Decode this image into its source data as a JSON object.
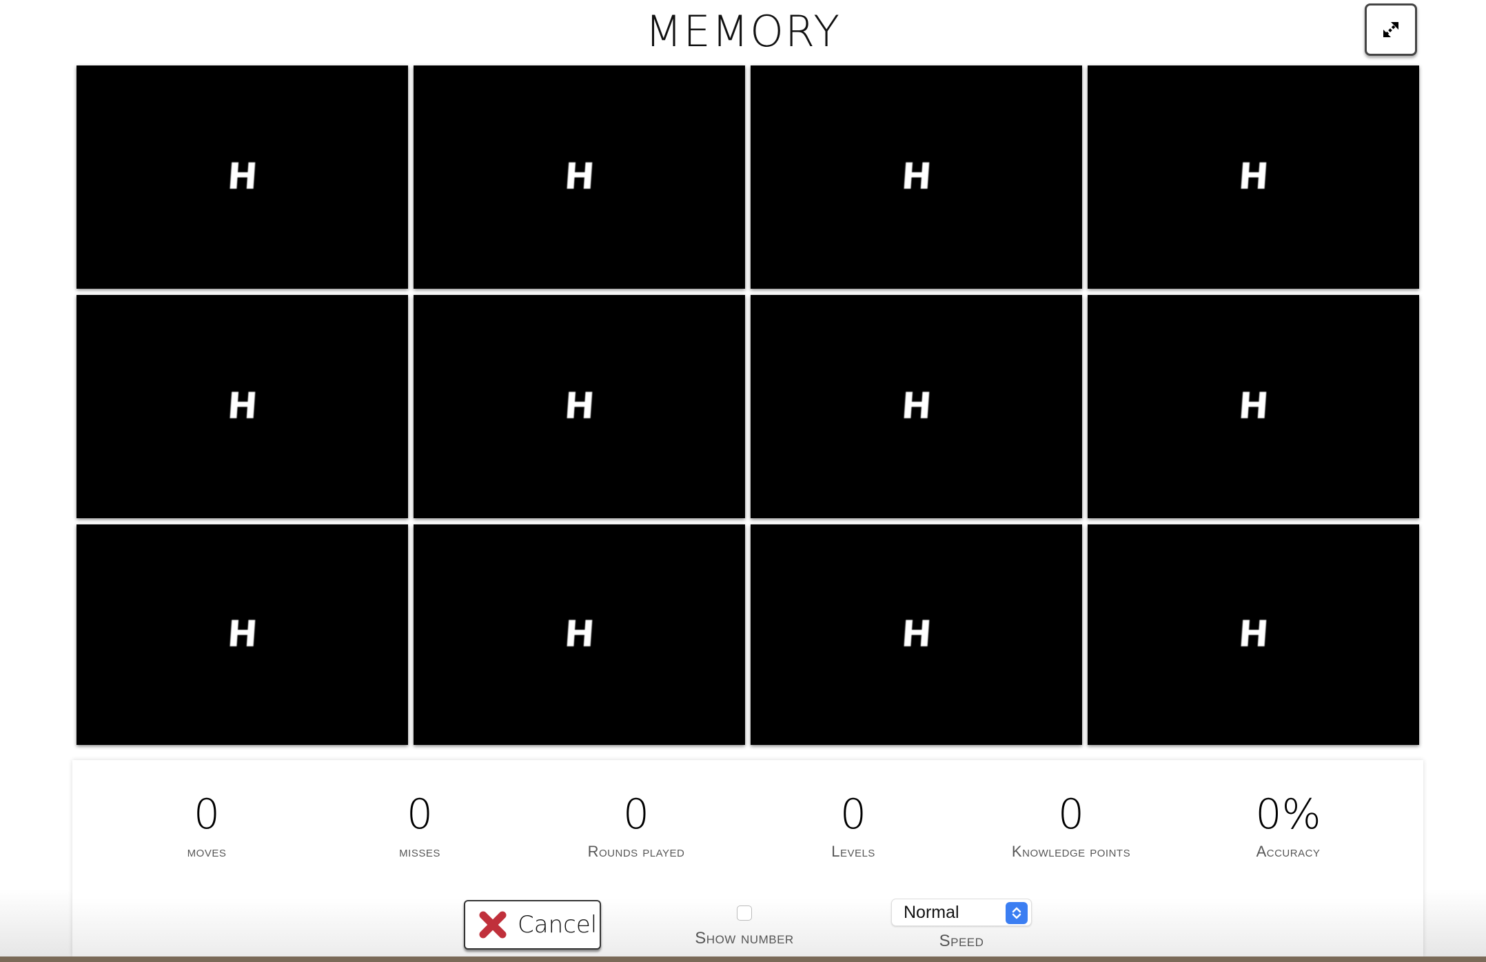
{
  "header": {
    "title": "MEMORY",
    "fullscreen_icon": "expand-arrows-icon"
  },
  "cards": [
    {
      "glyph": "H",
      "state": "face-down"
    },
    {
      "glyph": "H",
      "state": "face-down"
    },
    {
      "glyph": "H",
      "state": "face-down"
    },
    {
      "glyph": "H",
      "state": "face-down"
    },
    {
      "glyph": "H",
      "state": "face-down"
    },
    {
      "glyph": "H",
      "state": "face-down"
    },
    {
      "glyph": "H",
      "state": "face-down"
    },
    {
      "glyph": "H",
      "state": "face-down"
    },
    {
      "glyph": "H",
      "state": "face-down"
    },
    {
      "glyph": "H",
      "state": "face-down"
    },
    {
      "glyph": "H",
      "state": "face-down"
    },
    {
      "glyph": "H",
      "state": "face-down"
    }
  ],
  "stats": [
    {
      "value": "0",
      "label": "moves"
    },
    {
      "value": "0",
      "label": "misses"
    },
    {
      "value": "0",
      "label": "Rounds played"
    },
    {
      "value": "0",
      "label": "Levels"
    },
    {
      "value": "0",
      "label": "Knowledge points"
    },
    {
      "value": "0%",
      "label": "Accuracy"
    }
  ],
  "controls": {
    "cancel_label": "Cancel",
    "cancel_icon": "red-x-icon",
    "show_number_label": "Show number",
    "show_number_checked": false,
    "speed_label": "Speed",
    "speed_value": "Normal"
  },
  "colors": {
    "card_back": "#000000",
    "cancel_icon": "#c0303b",
    "select_accent": "#3b7ef2",
    "bottom_band": "#7a6a58"
  }
}
